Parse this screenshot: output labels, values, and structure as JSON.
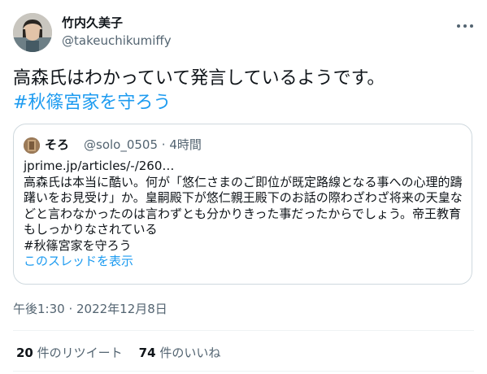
{
  "author": {
    "display_name": "竹内久美子",
    "handle": "@takeuchikumiffy"
  },
  "tweet": {
    "text": "高森氏はわかっていて発言しているようです。",
    "hashtag": "#秋篠宮家を守ろう",
    "timestamp": "午後1:30 · 2022年12月8日"
  },
  "quoted_tweet": {
    "display_name": "そろ",
    "handle": "@solo_0505",
    "age": "· 4時間",
    "url_line": "jprime.jp/articles/-/260…",
    "lines": [
      "高森氏は本当に酷い。何が「悠仁さまのご即位が既定路線となる事への心理的躊",
      "躇いをお見受け」か。皇嗣殿下が悠仁親王殿下のお話の際わざわざ将来の天皇な",
      "どと言わなかったのは言わずとも分かりきった事だったからでしょう。帝王教育",
      "もしっかりなされている"
    ],
    "hashtag": "#秋篠宮家を守ろう",
    "show_thread": "このスレッドを表示"
  },
  "stats": {
    "retweets_count": "20",
    "retweets_label": "件のリツイート",
    "likes_count": "74",
    "likes_label": "件のいいね"
  },
  "icons": {
    "more": "more-options-icon"
  },
  "colors": {
    "accent": "#1d9bf0",
    "text_primary": "#0f1419",
    "text_secondary": "#536471",
    "border": "#cfd9de"
  }
}
